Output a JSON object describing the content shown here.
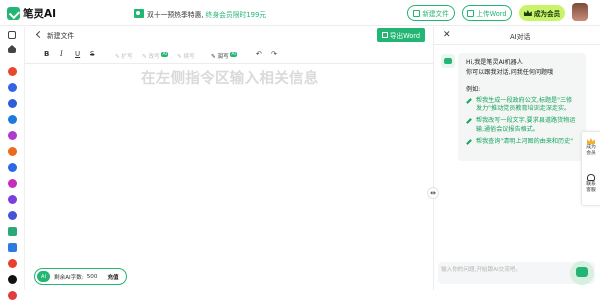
{
  "app": {
    "name": "笔灵AI"
  },
  "promo": {
    "text": "双十一预热季特惠,",
    "link": "终身会员限时199元"
  },
  "header": {
    "new_file": "新建文件",
    "upload_word": "上传Word",
    "vip": "成为会员"
  },
  "editor": {
    "doc_title": "新建文件",
    "export_label": "导出Word",
    "tools": {
      "bold": "B",
      "italic": "I",
      "underline": "U",
      "strike": "S",
      "expand": "扩写",
      "rewrite": "改写",
      "continue": "续写",
      "polish": "润写",
      "undo": "↶",
      "redo": "↷",
      "pill": "AI"
    },
    "placeholder": "在左侧指令区输入相关信息",
    "word_count": {
      "badge": "AI",
      "label": "剩余AI字数:",
      "value": "500",
      "charge": "充值"
    }
  },
  "ai_panel": {
    "title": "AI对话",
    "greeting_1": "Hi,我是笔灵AI机器人",
    "greeting_2": "你可以跟我对话,问我任何问题哦",
    "examples_label": "例如:",
    "examples": [
      "帮我生成一段政府公文,标题是\"三修发力\"推动党员教育培训走深走实。",
      "帮我改写一段文字,要求县道路货物运输,通俗会议报告格式。",
      "帮我查询\"清明上河图的由来和历史\""
    ],
    "input_placeholder": "输入你的问题,开始跟AI交流吧。"
  },
  "float_side": {
    "vip": "成为\n会员",
    "contact": "联系\n客服"
  },
  "colors": {
    "brand": "#22b573",
    "vip_bg": "#c9f36a"
  }
}
